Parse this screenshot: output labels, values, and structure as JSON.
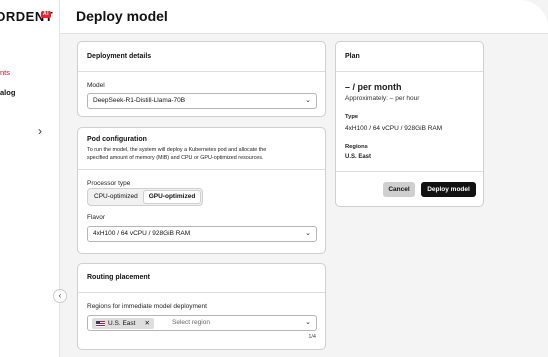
{
  "app": {
    "logo_text": "ƆRDENT",
    "logo_badge": "AI"
  },
  "sidebar": {
    "items": [
      {
        "label": "nts",
        "active": true
      },
      {
        "label": "alog",
        "active": false
      }
    ],
    "expand_icon": "chevron-right-icon",
    "collapse_icon": "chevron-left-icon"
  },
  "header": {
    "title": "Deploy model"
  },
  "deployment": {
    "title": "Deployment details",
    "model_label": "Model",
    "model_value": "DeepSeek-R1-Distill-Llama-70B"
  },
  "pod": {
    "title": "Pod configuration",
    "desc_line1": "To run the model, the system will deploy a Kubernetes pod and allocate the",
    "desc_line2": "specified amount of memory (MiB) and CPU or GPU-optimized resources.",
    "processor_label": "Processor type",
    "processor_options": [
      "CPU-optimized",
      "GPU-optimized"
    ],
    "processor_selected": "GPU-optimized",
    "flavor_label": "Flavor",
    "flavor_value": "4xH100 / 64 vCPU / 928GiB RAM"
  },
  "routing": {
    "title": "Routing placement",
    "regions_label": "Regions for immediate model deployment",
    "selected_region": "U.S. East",
    "placeholder": "Select region",
    "count": "1/4"
  },
  "plan": {
    "title": "Plan",
    "price": "– / per month",
    "approx": "Approximately: – per hour",
    "type_label": "Type",
    "type_value": "4xH100 / 64 vCPU / 928GiB RAM",
    "regions_label": "Regions",
    "regions_value": "U.S. East",
    "cancel_label": "Cancel",
    "deploy_label": "Deploy model"
  },
  "colors": {
    "accent": "#c8102e",
    "primary_button": "#111111",
    "secondary_button": "#cfcfcf"
  }
}
